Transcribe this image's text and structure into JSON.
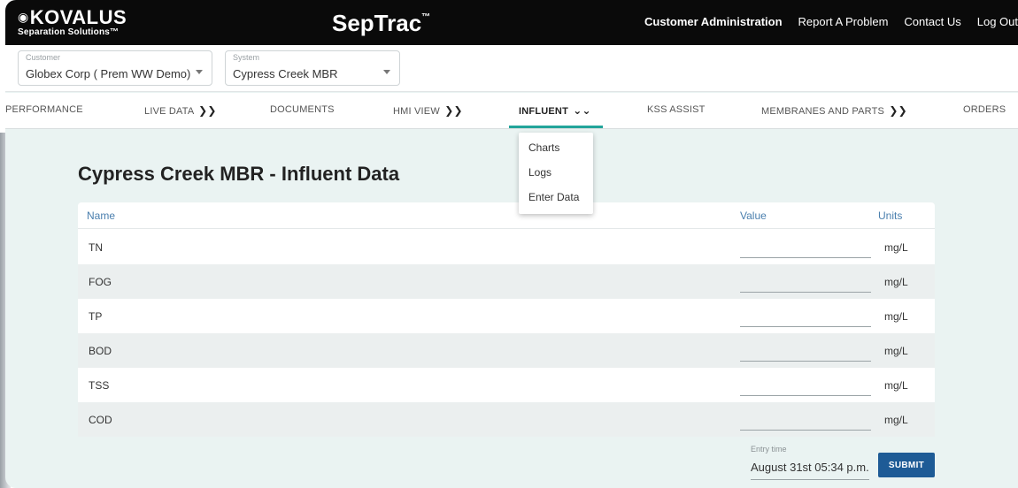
{
  "brand": {
    "logo_mark": "◉",
    "logo_main": "KOVALUS",
    "logo_sub": "Separation Solutions™",
    "app_title": "SepTrac",
    "app_title_tm": "™"
  },
  "top_links": [
    {
      "label": "Customer Administration"
    },
    {
      "label": "Report A Problem"
    },
    {
      "label": "Contact Us"
    },
    {
      "label": "Log Out"
    }
  ],
  "selectors": {
    "customer": {
      "label": "Customer",
      "value": "Globex Corp ( Prem WW Demo)"
    },
    "system": {
      "label": "System",
      "value": "Cypress Creek MBR"
    }
  },
  "nav": [
    {
      "label": "PERFORMANCE",
      "chevron": ""
    },
    {
      "label": "LIVE DATA",
      "chevron": "❯❯"
    },
    {
      "label": "DOCUMENTS",
      "chevron": ""
    },
    {
      "label": "HMI VIEW",
      "chevron": "❯❯"
    },
    {
      "label": "INFLUENT",
      "chevron": "⌄⌄"
    },
    {
      "label": "KSS ASSIST",
      "chevron": ""
    },
    {
      "label": "MEMBRANES AND PARTS",
      "chevron": "❯❯"
    },
    {
      "label": "ORDERS",
      "chevron": ""
    }
  ],
  "influent_menu": [
    "Charts",
    "Logs",
    "Enter Data"
  ],
  "page_title": "Cypress Creek MBR - Influent Data",
  "table": {
    "headers": {
      "name": "Name",
      "value": "Value",
      "units": "Units"
    },
    "rows": [
      {
        "name": "TN",
        "value": "",
        "units": "mg/L"
      },
      {
        "name": "FOG",
        "value": "",
        "units": "mg/L"
      },
      {
        "name": "TP",
        "value": "",
        "units": "mg/L"
      },
      {
        "name": "BOD",
        "value": "",
        "units": "mg/L"
      },
      {
        "name": "TSS",
        "value": "",
        "units": "mg/L"
      },
      {
        "name": "COD",
        "value": "",
        "units": "mg/L"
      }
    ]
  },
  "entry_time": {
    "label": "Entry time",
    "value": "August 31st 05:34 p.m."
  },
  "submit_label": "SUBMIT",
  "colors": {
    "accent": "#22a49a",
    "header_text": "#4a7fae",
    "submit": "#1e5b96",
    "background": "#eaf3f2"
  }
}
